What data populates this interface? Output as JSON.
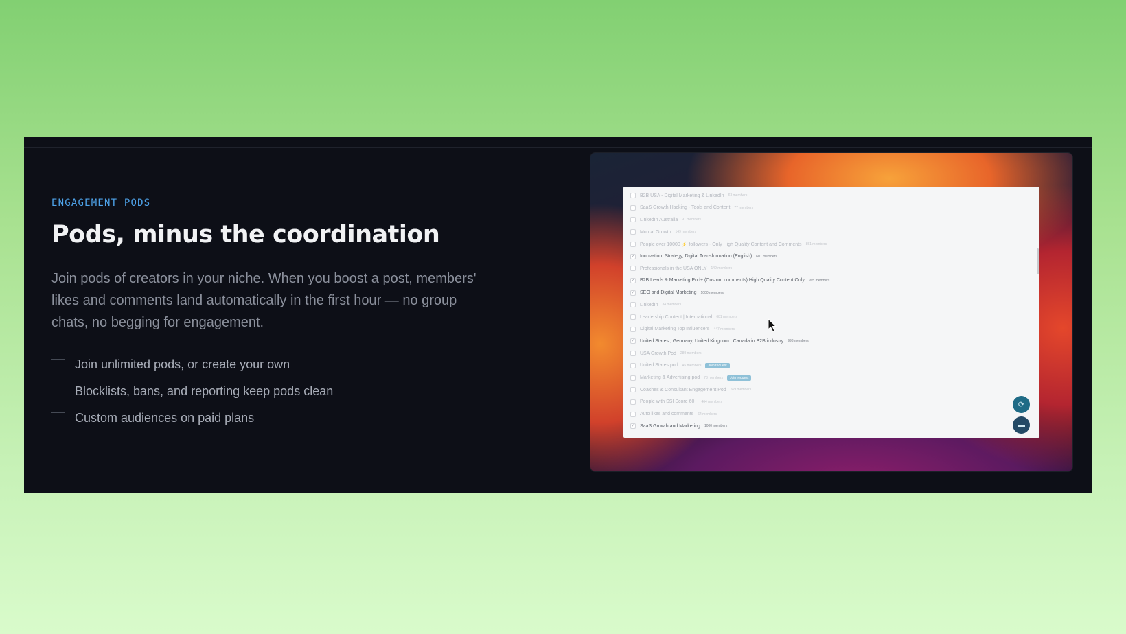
{
  "section": {
    "eyebrow": "ENGAGEMENT PODS",
    "title": "Pods, minus the coordination",
    "description": "Join pods of creators in your niche. When you boost a post, members' likes and comments land automatically in the first hour — no group chats, no begging for engagement.",
    "features": [
      "Join unlimited pods, or create your own",
      "Blocklists, bans, and reporting keep pods clean",
      "Custom audiences on paid plans"
    ]
  },
  "screenshot": {
    "pods": [
      {
        "name": "B2B USA - Digital Marketing & LinkedIn",
        "meta": "63 members",
        "checked": false
      },
      {
        "name": "SaaS Growth Hacking - Tools and Content",
        "meta": "77 members",
        "checked": false
      },
      {
        "name": "LinkedIn Australia",
        "meta": "91 members",
        "checked": false
      },
      {
        "name": "Mutual Growth",
        "meta": "149 members",
        "checked": false
      },
      {
        "name": "People over 10000 ⚡ followers - Only High Quality Content and Comments",
        "meta": "851 members",
        "checked": false
      },
      {
        "name": "Innovation, Strategy, Digital Transformation (English)",
        "meta": "601 members",
        "checked": true
      },
      {
        "name": "Professionals in the USA ONLY",
        "meta": "149 members",
        "checked": false
      },
      {
        "name": "B2B Leads & Marketing Pod+ (Custom comments) High Quality Content Only",
        "meta": "995 members",
        "checked": true
      },
      {
        "name": "SEO and Digital Marketing",
        "meta": "1000 members",
        "checked": true
      },
      {
        "name": "LinkedIn",
        "meta": "34 members",
        "checked": false
      },
      {
        "name": "Leadership Content | International",
        "meta": "681 members",
        "checked": false
      },
      {
        "name": "Digital Marketing Top Influencers",
        "meta": "447 members",
        "checked": false
      },
      {
        "name": "United States , Germany, United Kingdom , Canada in B2B industry",
        "meta": "993 members",
        "checked": true
      },
      {
        "name": "USA Growth Pod",
        "meta": "289 members",
        "checked": false
      },
      {
        "name": "United States pod",
        "meta": "45 members",
        "checked": false,
        "tag": "Join request"
      },
      {
        "name": "Marketing & Advertising pod",
        "meta": "73 members",
        "checked": false,
        "tag": "Join request"
      },
      {
        "name": "Coaches & Consultant Engagement Pod",
        "meta": "569 members",
        "checked": false
      },
      {
        "name": "People with SSI Score 60+",
        "meta": "464 members",
        "checked": false
      },
      {
        "name": "Auto likes and comments",
        "meta": "64 members",
        "checked": false
      },
      {
        "name": "SaaS Growth and Marketing",
        "meta": "1000 members",
        "checked": true
      }
    ],
    "check_glyph": "✓",
    "fab_icons": [
      "refresh-icon",
      "chat-icon"
    ]
  }
}
